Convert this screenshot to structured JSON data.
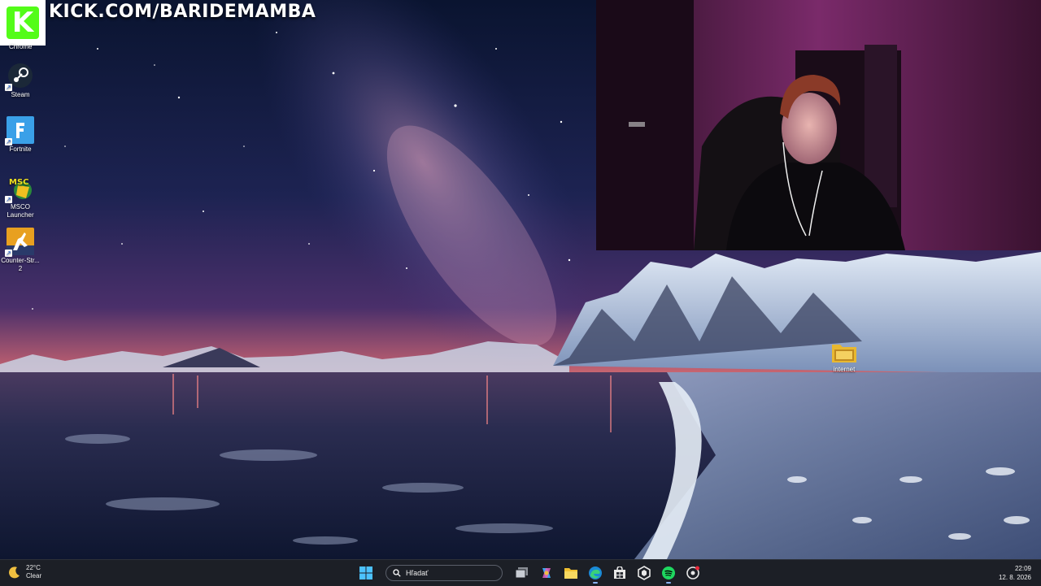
{
  "overlay": {
    "channel_url": "KICK.COM/BARIDEMAMBA",
    "logo_letter": "K",
    "brand_color": "#53fc18"
  },
  "desktop": {
    "icons": [
      {
        "label": "Chrome",
        "icon": "chrome-icon"
      },
      {
        "label": "Steam",
        "icon": "steam-icon"
      },
      {
        "label": "Fortnite",
        "icon": "fortnite-icon"
      },
      {
        "label": "MSCO Launcher",
        "icon": "msco-launcher-icon"
      },
      {
        "label": "Counter-Str... 2",
        "icon": "counter-strike-icon"
      },
      {
        "label": "internet",
        "icon": "folder-icon"
      }
    ]
  },
  "taskbar": {
    "weather": {
      "temperature": "22°C",
      "condition": "Clear",
      "icon": "moon-icon"
    },
    "search_placeholder": "Hľadať",
    "apps": [
      "windows-start-icon",
      "search-icon",
      "task-view-icon",
      "copilot-icon",
      "file-explorer-icon",
      "edge-icon",
      "store-icon",
      "office-icon",
      "spotify-icon",
      "game-launcher-icon"
    ],
    "clock": {
      "time": "22:09",
      "date": "12. 8. 2026"
    }
  }
}
